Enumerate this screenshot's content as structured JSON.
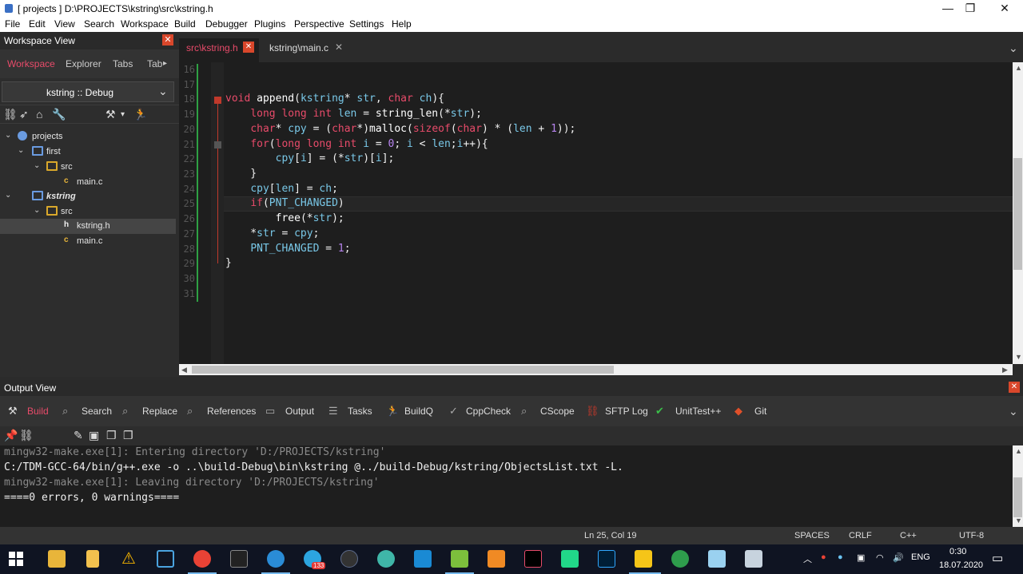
{
  "window": {
    "title": "[ projects ] D:\\PROJECTS\\kstring\\src\\kstring.h",
    "minimize": "—",
    "maximize": "❐",
    "close": "✕"
  },
  "menu": [
    "File",
    "Edit",
    "View",
    "Search",
    "Workspace",
    "Build",
    "Debugger",
    "Plugins",
    "Perspective",
    "Settings",
    "Help"
  ],
  "workspace": {
    "header": "Workspace View",
    "tabs": [
      "Workspace",
      "Explorer",
      "Tabs",
      "Tab"
    ],
    "config": "kstring :: Debug",
    "tree": [
      {
        "label": "projects",
        "type": "workspace"
      },
      {
        "label": "first",
        "type": "project"
      },
      {
        "label": "src",
        "type": "folder"
      },
      {
        "label": "main.c",
        "type": "c"
      },
      {
        "label": "kstring",
        "type": "project"
      },
      {
        "label": "src",
        "type": "folder"
      },
      {
        "label": "kstring.h",
        "type": "h"
      },
      {
        "label": "main.c",
        "type": "c"
      }
    ],
    "file_glyph_c": "c",
    "file_glyph_h": "h"
  },
  "editor": {
    "tabs": [
      {
        "label": "src\\kstring.h",
        "active": true
      },
      {
        "label": "kstring\\main.c",
        "active": false
      }
    ],
    "line_numbers": [
      "16",
      "17",
      "18",
      "19",
      "20",
      "21",
      "22",
      "23",
      "24",
      "25",
      "26",
      "27",
      "28",
      "29",
      "30",
      "31"
    ]
  },
  "output": {
    "header": "Output View",
    "tabs": [
      "Build",
      "Search",
      "Replace",
      "References",
      "Output",
      "Tasks",
      "BuildQ",
      "CppCheck",
      "CScope",
      "SFTP Log",
      "UnitTest++",
      "Git"
    ],
    "lines": [
      "mingw32-make.exe[1]: Entering directory 'D:/PROJECTS/kstring'",
      "C:/TDM-GCC-64/bin/g++.exe -o ..\\build-Debug\\bin\\kstring @../build-Debug/kstring/ObjectsList.txt -L.",
      "mingw32-make.exe[1]: Leaving directory 'D:/PROJECTS/kstring'",
      "====0 errors, 0 warnings===="
    ]
  },
  "status": {
    "position": "Ln 25, Col 19",
    "indent": "SPACES",
    "eol": "CRLF",
    "lang": "C++",
    "encoding": "UTF-8"
  },
  "taskbar": {
    "lang": "ENG",
    "time": "0:30",
    "date": "18.07.2020",
    "badge": "133"
  },
  "colors": {
    "accent": "#e84b6a",
    "close": "#d9472b",
    "identifier": "#79c8e8",
    "number": "#b784ef"
  }
}
